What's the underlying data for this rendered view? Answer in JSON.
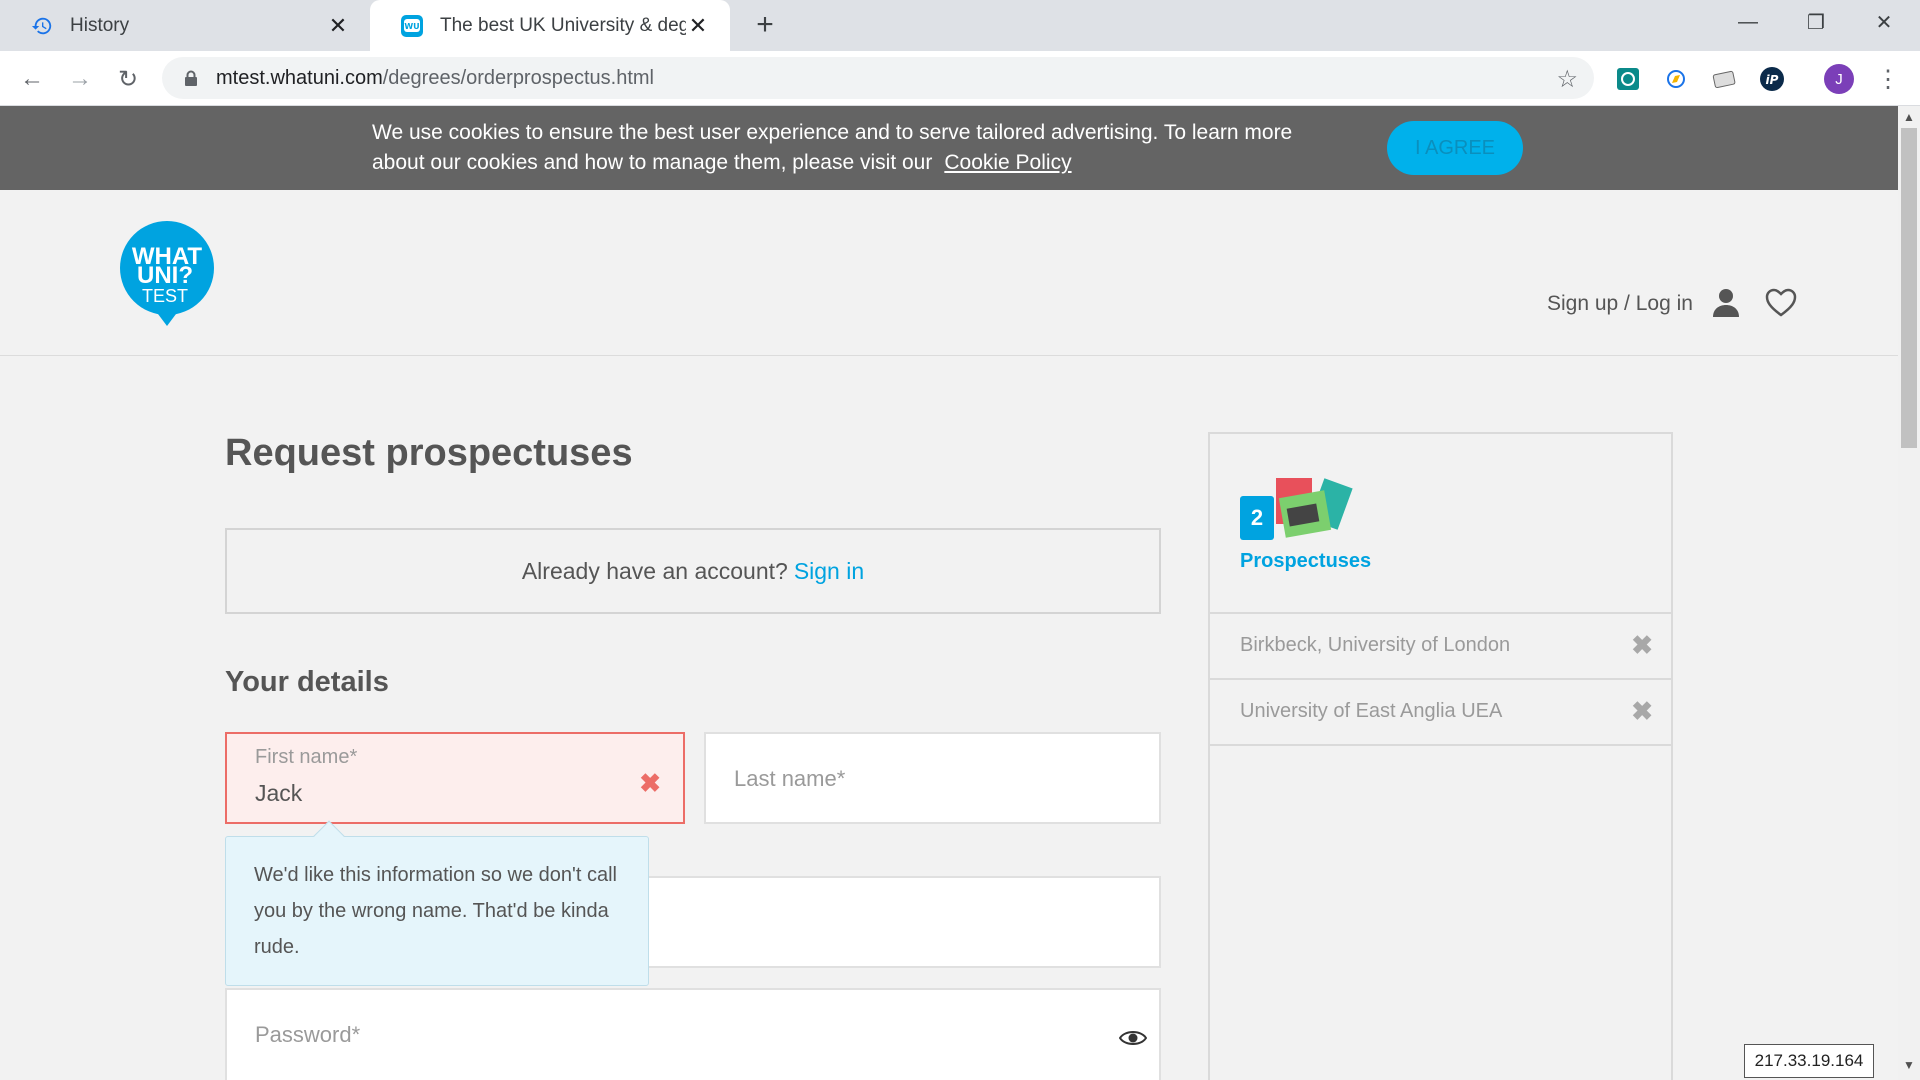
{
  "browser": {
    "tabs": [
      {
        "title": "History",
        "active": false
      },
      {
        "title": "The best UK University & degree",
        "active": true
      }
    ],
    "url_host": "mtest.whatuni.com",
    "url_path": "/degrees/orderprospectus.html",
    "profile_initial": "J"
  },
  "cookie_banner": {
    "text": "We use cookies to ensure the best user experience and to serve tailored advertising. To learn more about our cookies and how to manage them, please visit our",
    "link": "Cookie Policy",
    "agree": "I AGREE"
  },
  "header": {
    "logo_line1": "WHAT",
    "logo_line2": "UNI?",
    "logo_line3": "TEST",
    "signup": "Sign up / Log in"
  },
  "main": {
    "title": "Request prospectuses",
    "account_prompt": "Already have an account?",
    "signin": "Sign in",
    "details_title": "Your details",
    "first_name_label": "First name*",
    "first_name_value": "Jack",
    "last_name_placeholder": "Last name*",
    "password_placeholder": "Password*",
    "tooltip": "We'd like this information so we don't call you by the wrong name. That'd be kinda rude."
  },
  "sidebar": {
    "count": "2",
    "label": "Prospectuses",
    "items": [
      {
        "name": "Birkbeck, University of London"
      },
      {
        "name": "University of East Anglia UEA"
      }
    ]
  },
  "ip_address": "217.33.19.164",
  "colors": {
    "accent": "#00a3e0",
    "error": "#ec6d67",
    "cookie_bg": "#646464"
  }
}
